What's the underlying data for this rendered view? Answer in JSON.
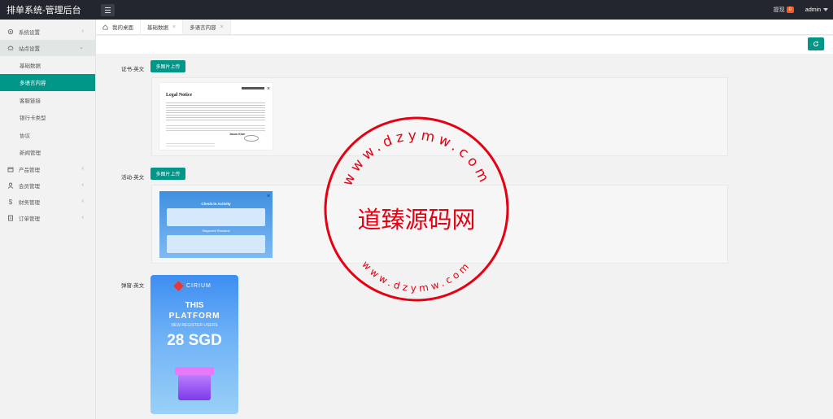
{
  "app": {
    "title": "排单系统-管理后台",
    "notice_label": "提现",
    "notice_count": "0",
    "user": "admin"
  },
  "sidebar": {
    "items": [
      {
        "label": "系统设置",
        "icon": "gear-icon"
      },
      {
        "label": "站点设置",
        "icon": "site-icon"
      },
      {
        "label": "产品管理",
        "icon": "box-icon"
      },
      {
        "label": "会员管理",
        "icon": "user-icon"
      },
      {
        "label": "财务管理",
        "icon": "dollar-icon"
      },
      {
        "label": "订单管理",
        "icon": "order-icon"
      }
    ],
    "sub_items": [
      "基础数据",
      "多语言内容",
      "客服链接",
      "银行卡类型",
      "协议",
      "新闻管理"
    ]
  },
  "tabs": [
    {
      "label": "我的桌面",
      "icon": "home-icon"
    },
    {
      "label": "基础数据"
    },
    {
      "label": "多语言内容"
    }
  ],
  "form": {
    "rows": [
      {
        "label": "证书-英文",
        "button": "多图片上传"
      },
      {
        "label": "活动-英文",
        "button": "多图片上传"
      },
      {
        "label": "弹窗-英文"
      }
    ]
  },
  "thumbs": {
    "legal": {
      "title": "Legal Notice",
      "signer": "Jason Kiwe"
    },
    "activity": {
      "heading": "Check-in Activity",
      "subheading": "Stagewell Rewards"
    },
    "popup": {
      "brand": "CIRIUM",
      "line1": "THIS",
      "line2": "PLATFORM",
      "line3": "NEW REGISTER USERS",
      "amount": "28 SGD"
    }
  },
  "watermark": {
    "center": "道臻源码网",
    "ring_top": "www.dzymw.com",
    "ring_bottom": "www.dzymw.com"
  },
  "colors": {
    "accent": "#009688",
    "topbar": "#23262e",
    "badge": "#ff5722",
    "stamp": "#e60012"
  }
}
